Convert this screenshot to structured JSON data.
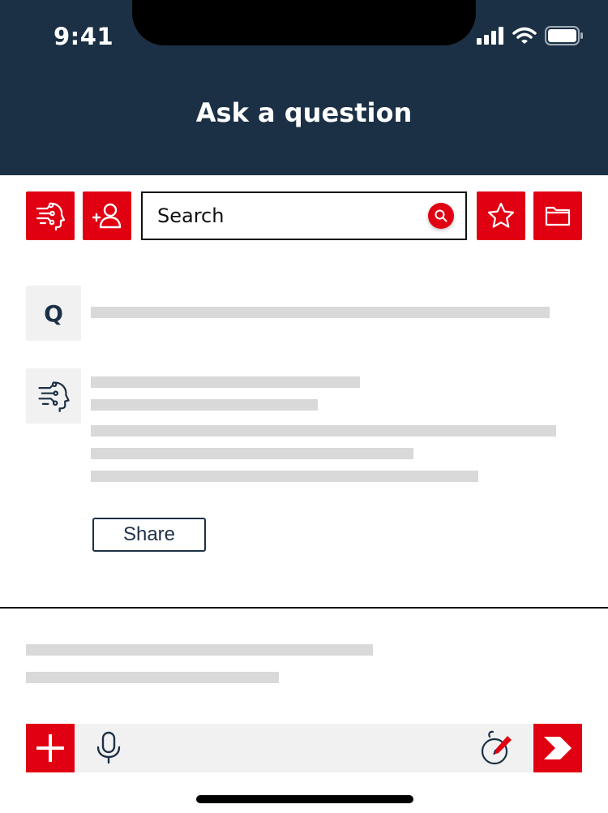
{
  "status_bar": {
    "time": "9:41"
  },
  "header": {
    "title": "Ask a question"
  },
  "toolbar": {
    "ai_icon": "ai-head-icon",
    "add_contact_icon": "add-user-icon",
    "favorites_icon": "star-icon",
    "folder_icon": "folder-icon"
  },
  "search": {
    "placeholder": "Search",
    "icon": "search-icon"
  },
  "question": {
    "avatar_letter": "Q"
  },
  "answer": {
    "avatar_icon": "ai-head-icon",
    "share_label": "Share"
  },
  "composer": {
    "add_icon": "plus-icon",
    "mic_icon": "microphone-icon",
    "draw_icon": "pen-icon",
    "send_icon": "send-icon"
  },
  "colors": {
    "header_bg": "#1b3045",
    "accent": "#e10012",
    "placeholder_line": "#d9d9d9"
  }
}
